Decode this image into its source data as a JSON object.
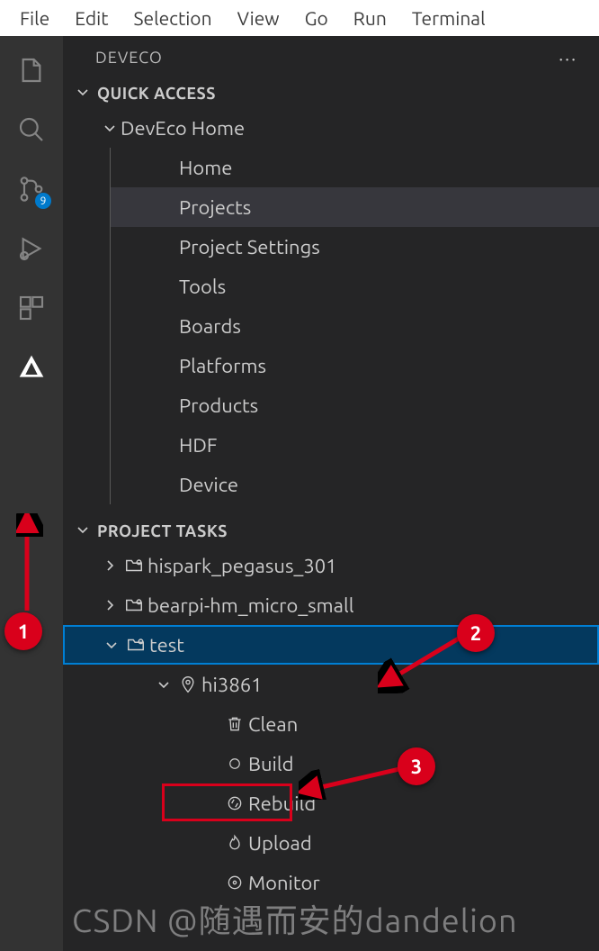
{
  "menubar": [
    "File",
    "Edit",
    "Selection",
    "View",
    "Go",
    "Run",
    "Terminal"
  ],
  "activity": {
    "source_control_badge": "9"
  },
  "sidebar": {
    "title": "DEVECO",
    "sections": {
      "quick_access": {
        "label": "QUICK ACCESS",
        "root": "DevEco Home",
        "items": [
          "Home",
          "Projects",
          "Project Settings",
          "Tools",
          "Boards",
          "Platforms",
          "Products",
          "HDF",
          "Device"
        ],
        "selected_index": 1
      },
      "project_tasks": {
        "label": "PROJECT TASKS",
        "projects": [
          {
            "name": "hispark_pegasus_301",
            "expanded": false
          },
          {
            "name": "bearpi-hm_micro_small",
            "expanded": false
          },
          {
            "name": "test",
            "expanded": true,
            "selected": true,
            "targets": [
              {
                "name": "hi3861",
                "expanded": true,
                "actions": [
                  "Clean",
                  "Build",
                  "Rebuild",
                  "Upload",
                  "Monitor"
                ],
                "highlighted_action_index": 1
              }
            ]
          }
        ]
      }
    }
  },
  "annotations": {
    "circle1": "1",
    "circle2": "2",
    "circle3": "3"
  },
  "watermark": "CSDN @随遇而安的dandelion"
}
